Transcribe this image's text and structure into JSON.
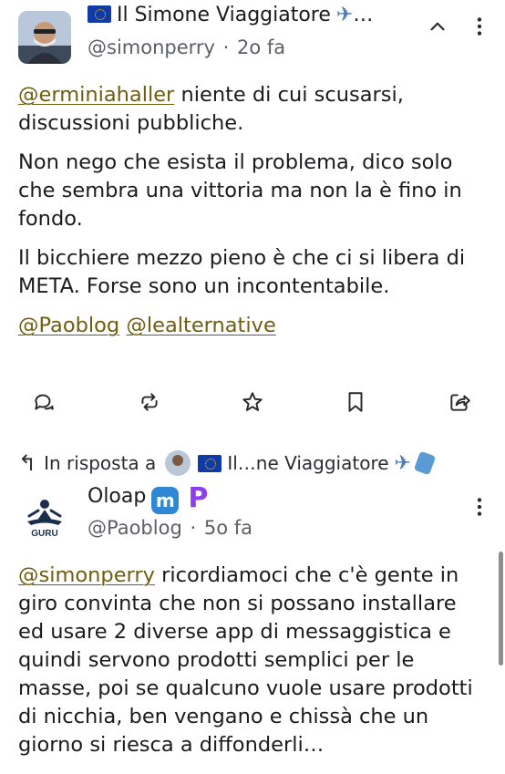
{
  "post1": {
    "display_name": "Il Simone Viaggiatore",
    "display_name_suffix": "…",
    "handle": "@simonperry",
    "separator": "·",
    "time": "2o fa",
    "paragraphs": [
      {
        "mention": "@erminiahaller",
        "text": " niente di cui scusarsi, discussioni pubbliche."
      },
      {
        "text": "Non nego che esista il problema, dico solo che sembra una vittoria ma non la è fino in fondo."
      },
      {
        "text": "Il bicchiere mezzo pieno è che ci si libera di META. Forse sono un incontentabile."
      }
    ],
    "tag_mentions": [
      "@Paoblog",
      "@lealternative"
    ],
    "actions": [
      "reply-icon",
      "boost-icon",
      "favourite-icon",
      "bookmark-icon",
      "share-icon"
    ]
  },
  "post2": {
    "reply_prefix": "In risposta a",
    "reply_target": "Il…ne Viaggiatore",
    "display_name": "Oloap",
    "avatar_text": "GURU",
    "handle": "@Paoblog",
    "separator": "·",
    "time": "5o fa",
    "mention": "@simonperry",
    "text": " ricordiamoci che c'è gente in giro convinta che non si possano installare ed usare 2 diverse app di messaggistica e quindi servono prodotti semplici per le masse, poi se qualcuno vuole usare prodotti di nicchia, ben vengano e chissà che un giorno si riesca a diffonderli…"
  },
  "colors": {
    "mention": "#6f5e10",
    "secondary_text": "#5d5e68",
    "mastodon_badge": "#3088d4",
    "pixelfed_badge": "#8c3ef0"
  }
}
